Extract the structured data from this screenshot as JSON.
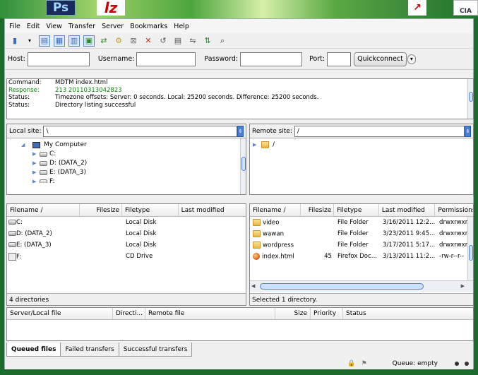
{
  "desktop": {
    "ps_label": "Ps",
    "fz_label": "lz",
    "pdf_label": "↗",
    "cia_label": "CIA"
  },
  "menu": [
    "File",
    "Edit",
    "View",
    "Transfer",
    "Server",
    "Bookmarks",
    "Help"
  ],
  "quickconnect": {
    "host_label": "Host:",
    "host_value": "",
    "username_label": "Username:",
    "username_value": "",
    "password_label": "Password:",
    "password_value": "",
    "port_label": "Port:",
    "port_value": "",
    "button_label": "Quickconnect",
    "dropdown_glyph": "▾"
  },
  "log": [
    {
      "key": "Command:",
      "text": "MDTM index.html",
      "green": false
    },
    {
      "key": "Response:",
      "text": "213 20110313042823",
      "green": true
    },
    {
      "key": "Status:",
      "text": "Timezone offsets: Server: 0 seconds. Local: 25200 seconds. Difference: 25200 seconds.",
      "green": false
    },
    {
      "key": "Status:",
      "text": "Directory listing successful",
      "green": false
    }
  ],
  "local": {
    "site_label": "Local site:",
    "path": "\\",
    "tree": [
      {
        "label": "My Computer"
      },
      {
        "label": "C:"
      },
      {
        "label": "D: (DATA_2)"
      },
      {
        "label": "E: (DATA_3)"
      },
      {
        "label": "F:"
      }
    ],
    "columns": [
      "Filename  /",
      "Filesize",
      "Filetype",
      "Last modified"
    ],
    "rows": [
      {
        "name": "C:",
        "size": "",
        "type": "Local Disk",
        "modified": "",
        "icon": "drive"
      },
      {
        "name": "D: (DATA_2)",
        "size": "",
        "type": "Local Disk",
        "modified": "",
        "icon": "drive"
      },
      {
        "name": "E: (DATA_3)",
        "size": "",
        "type": "Local Disk",
        "modified": "",
        "icon": "drive"
      },
      {
        "name": "F:",
        "size": "",
        "type": "CD Drive",
        "modified": "",
        "icon": "cd"
      }
    ],
    "status": "4 directories"
  },
  "remote": {
    "site_label": "Remote site:",
    "path": "/",
    "tree": [
      {
        "label": "/"
      }
    ],
    "columns": [
      "Filename  /",
      "Filesize",
      "Filetype",
      "Last modified",
      "Permissions"
    ],
    "rows": [
      {
        "name": "video",
        "size": "",
        "type": "File Folder",
        "modified": "3/16/2011 12:2...",
        "perm": "drwxrwxrwx",
        "icon": "folder"
      },
      {
        "name": "wawan",
        "size": "",
        "type": "File Folder",
        "modified": "3/23/2011 9:45...",
        "perm": "drwxrwxrwx",
        "icon": "folder"
      },
      {
        "name": "wordpress",
        "size": "",
        "type": "File Folder",
        "modified": "3/17/2011 5:17...",
        "perm": "drwxrwxrwx",
        "icon": "folder"
      },
      {
        "name": "index.html",
        "size": "45",
        "type": "Firefox Doc...",
        "modified": "3/13/2011 11:2...",
        "perm": "-rw-r--r--",
        "icon": "firefox"
      }
    ],
    "status": "Selected 1 directory."
  },
  "queue": {
    "columns": [
      "Server/Local file",
      "Directi...",
      "Remote file",
      "Size",
      "Priority",
      "Status"
    ]
  },
  "tabs": [
    "Queued files",
    "Failed transfers",
    "Successful transfers"
  ],
  "bottom_status": "Queue: empty"
}
